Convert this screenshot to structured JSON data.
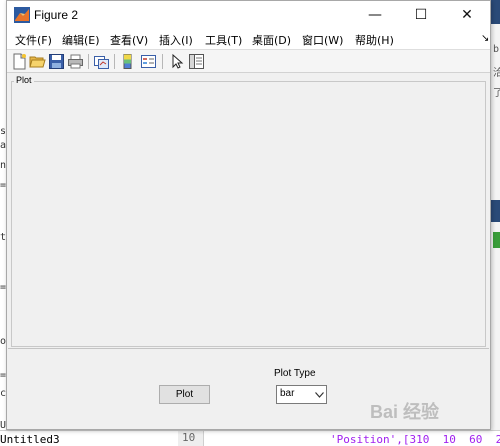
{
  "window": {
    "title": "Figure 2",
    "controls": {
      "minimize": "—",
      "maximize": "☐",
      "close": "✕"
    }
  },
  "menu": {
    "items": [
      "文件(F)",
      "编辑(E)",
      "查看(V)",
      "插入(I)",
      "工具(T)",
      "桌面(D)",
      "窗口(W)",
      "帮助(H)"
    ],
    "overflow": "↘"
  },
  "toolbar": {
    "icons": [
      "new-file-icon",
      "open-folder-icon",
      "save-icon",
      "print-icon",
      "link-plot-icon",
      "colorbar-icon",
      "legend-icon",
      "pointer-icon",
      "property-inspector-icon"
    ]
  },
  "panel": {
    "title": "Plot"
  },
  "controls": {
    "plot_button": "Plot",
    "plot_type_label": "Plot Type",
    "plot_type_value": "bar"
  },
  "background": {
    "left_fragments": [
      "s",
      "ar",
      "nf",
      "=",
      "ta",
      "=",
      "o",
      "=",
      "cc",
      "Ur",
      "Untitled3"
    ],
    "right_fragments": [
      "b",
      "洽",
      "了"
    ],
    "bottom_line_number": "10",
    "bottom_code": "'Position',[310  10  60  25"
  },
  "watermark": "Bai 经验"
}
